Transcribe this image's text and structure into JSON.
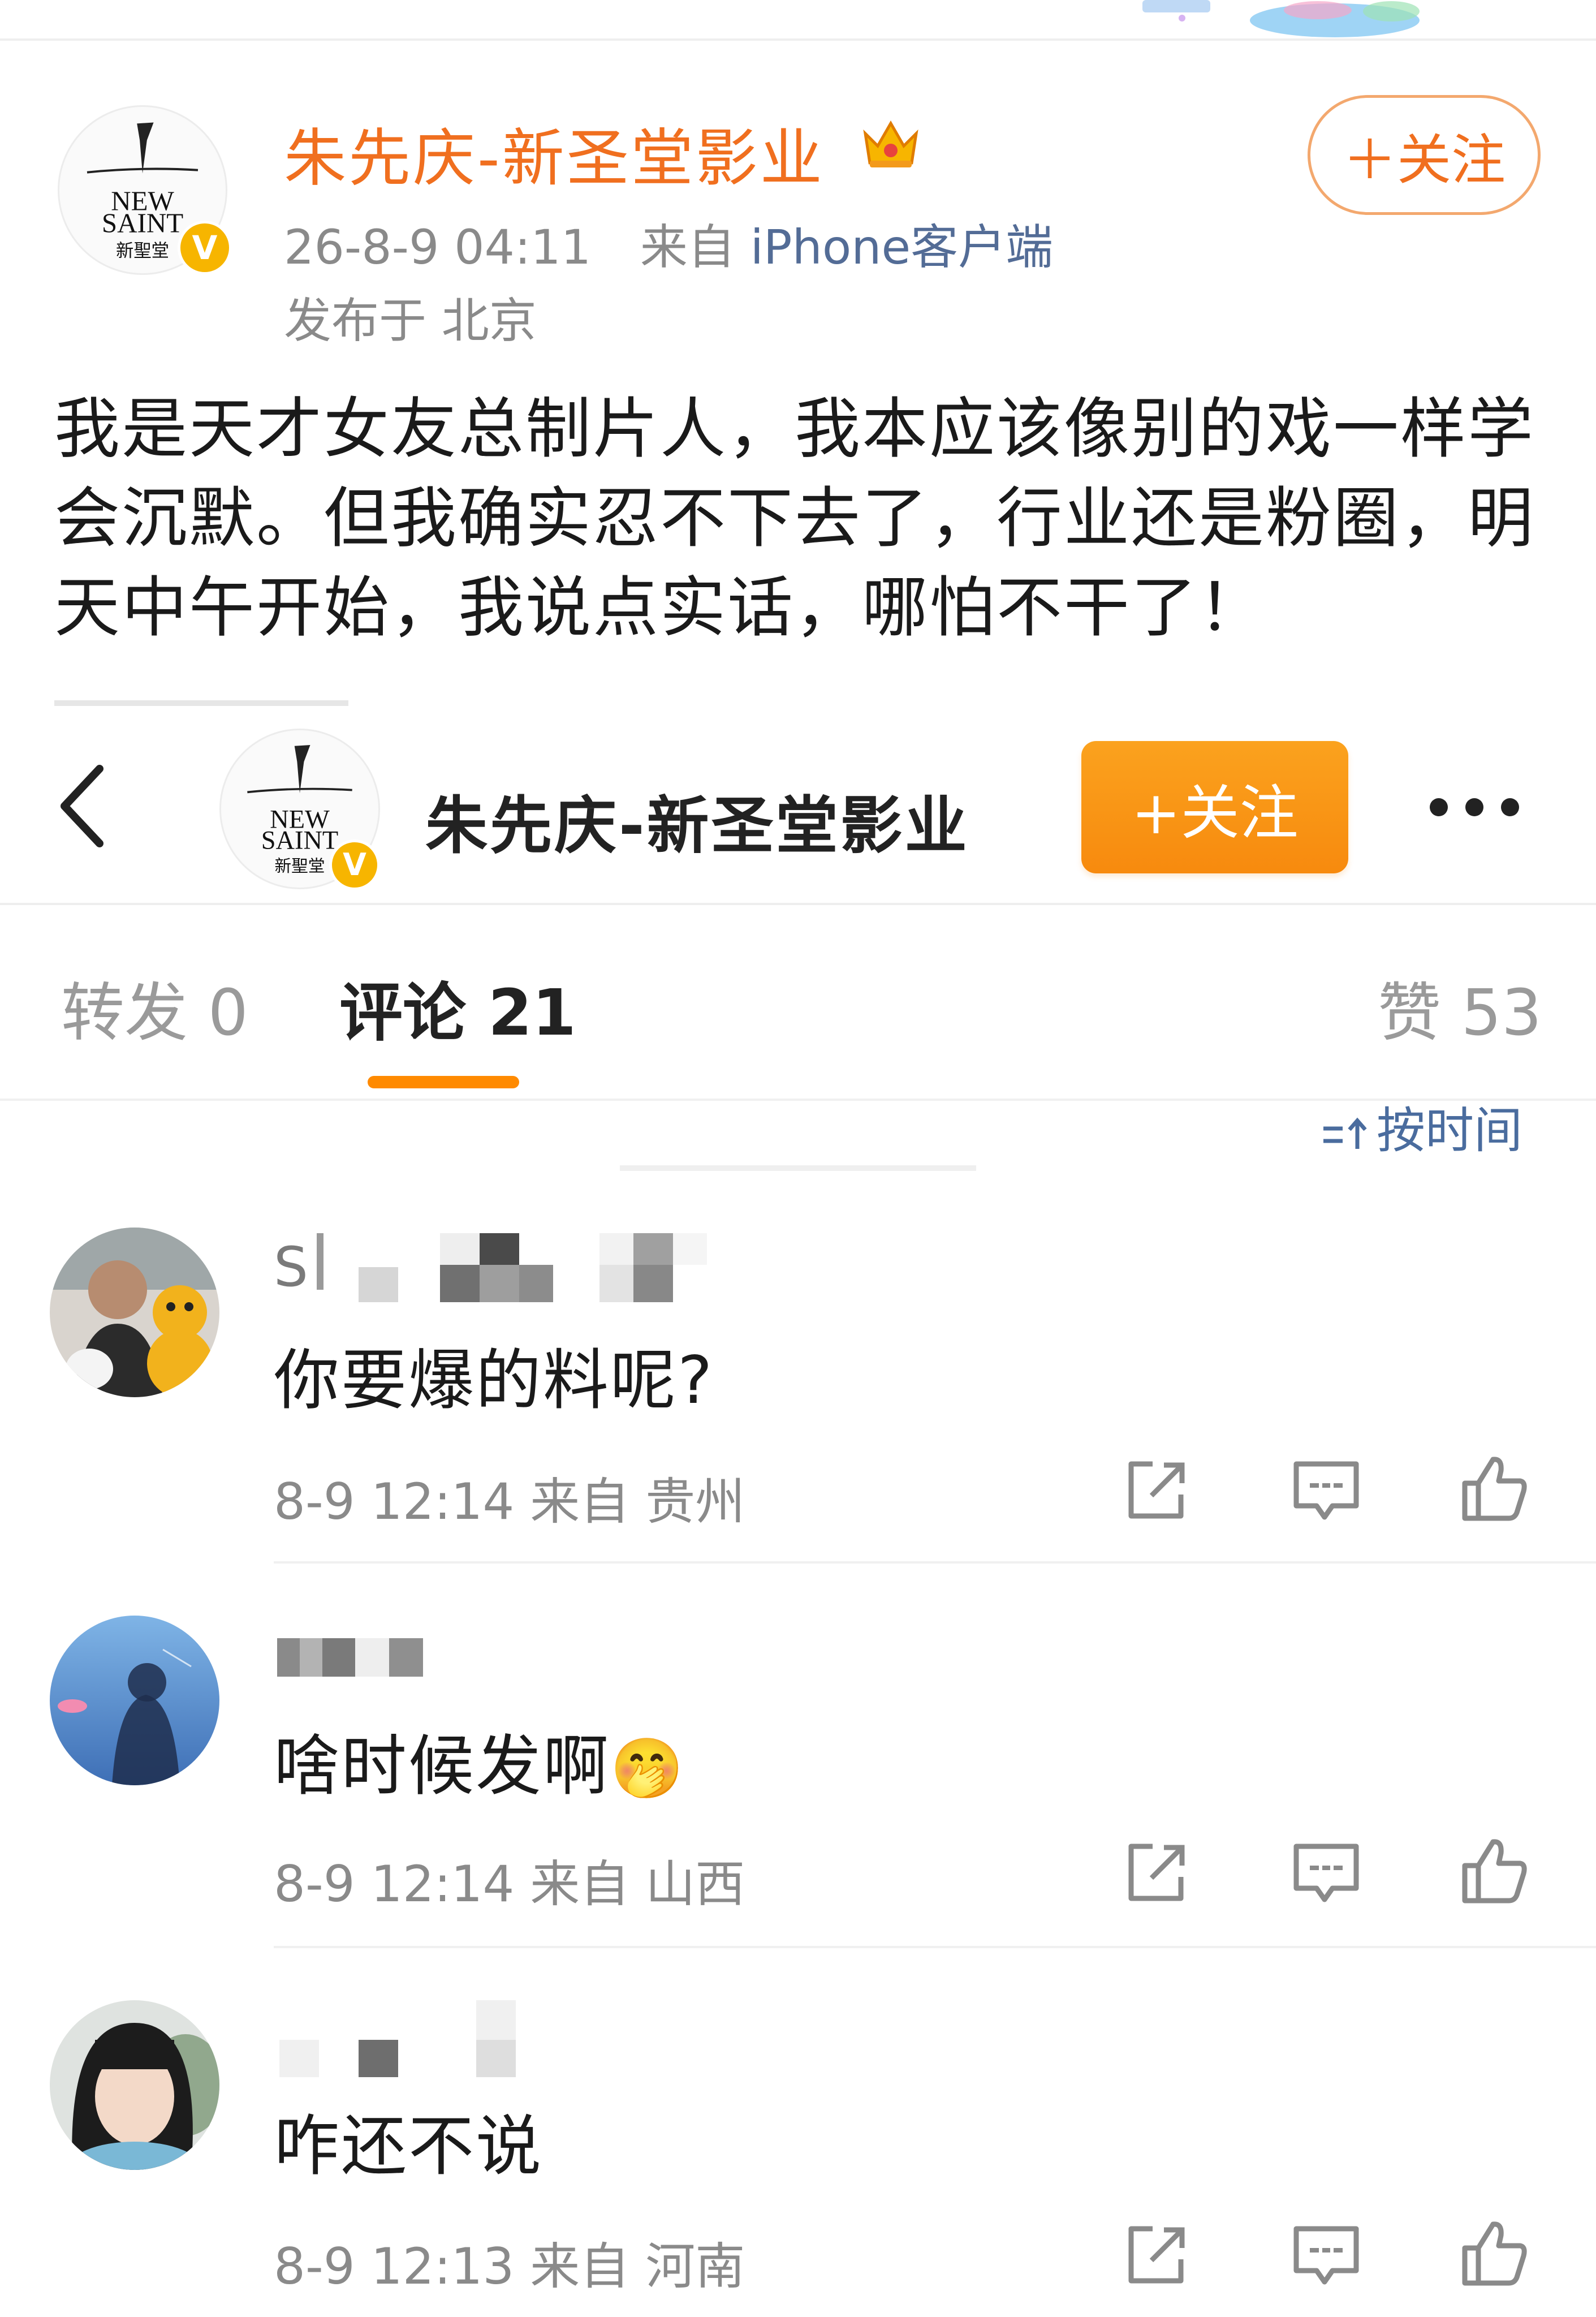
{
  "post": {
    "author_name": "朱先庆-新圣堂影业",
    "avatar_logo_line1": "NEW",
    "avatar_logo_line2": "SAINT",
    "avatar_logo_line3": "新聖堂",
    "timestamp": "26-8-9 04:11",
    "source_prefix": "来自",
    "source_client": "iPhone客户端",
    "location": "发布于 北京",
    "follow_label": "＋关注",
    "body": "我是天才女友总制片人，我本应该像别的戏一样学会沉默。但我确实忍不下去了，行业还是粉圈，明天中午开始，我说点实话，哪怕不干了！"
  },
  "sticky_header": {
    "name": "朱先庆-新圣堂影业",
    "follow_label": "+关注"
  },
  "tabs": {
    "repost": "转发 0",
    "comments": "评论 21",
    "likes": "赞 53",
    "sort_label": "按时间"
  },
  "comments": [
    {
      "name_partial": "S",
      "text": "你要爆的料呢?",
      "meta": "8-9 12:14  来自 贵州"
    },
    {
      "name_partial": "",
      "text": "啥时候发啊",
      "emoji": "🤭",
      "meta": "8-9 12:14  来自 山西"
    },
    {
      "name_partial": "",
      "text": "咋还不说",
      "meta": "8-9 12:13  来自 河南"
    }
  ],
  "colors": {
    "brand_orange": "#F06F1F",
    "follow_button": "#F78A0E",
    "link_blue": "#536C96",
    "verified": "#F7B500",
    "tab_indicator": "#FF8A00"
  },
  "icons": [
    "crown-icon",
    "verified-badge-icon",
    "back-arrow-icon",
    "more-icon",
    "sort-icon",
    "repost-icon",
    "comment-icon",
    "like-icon"
  ]
}
